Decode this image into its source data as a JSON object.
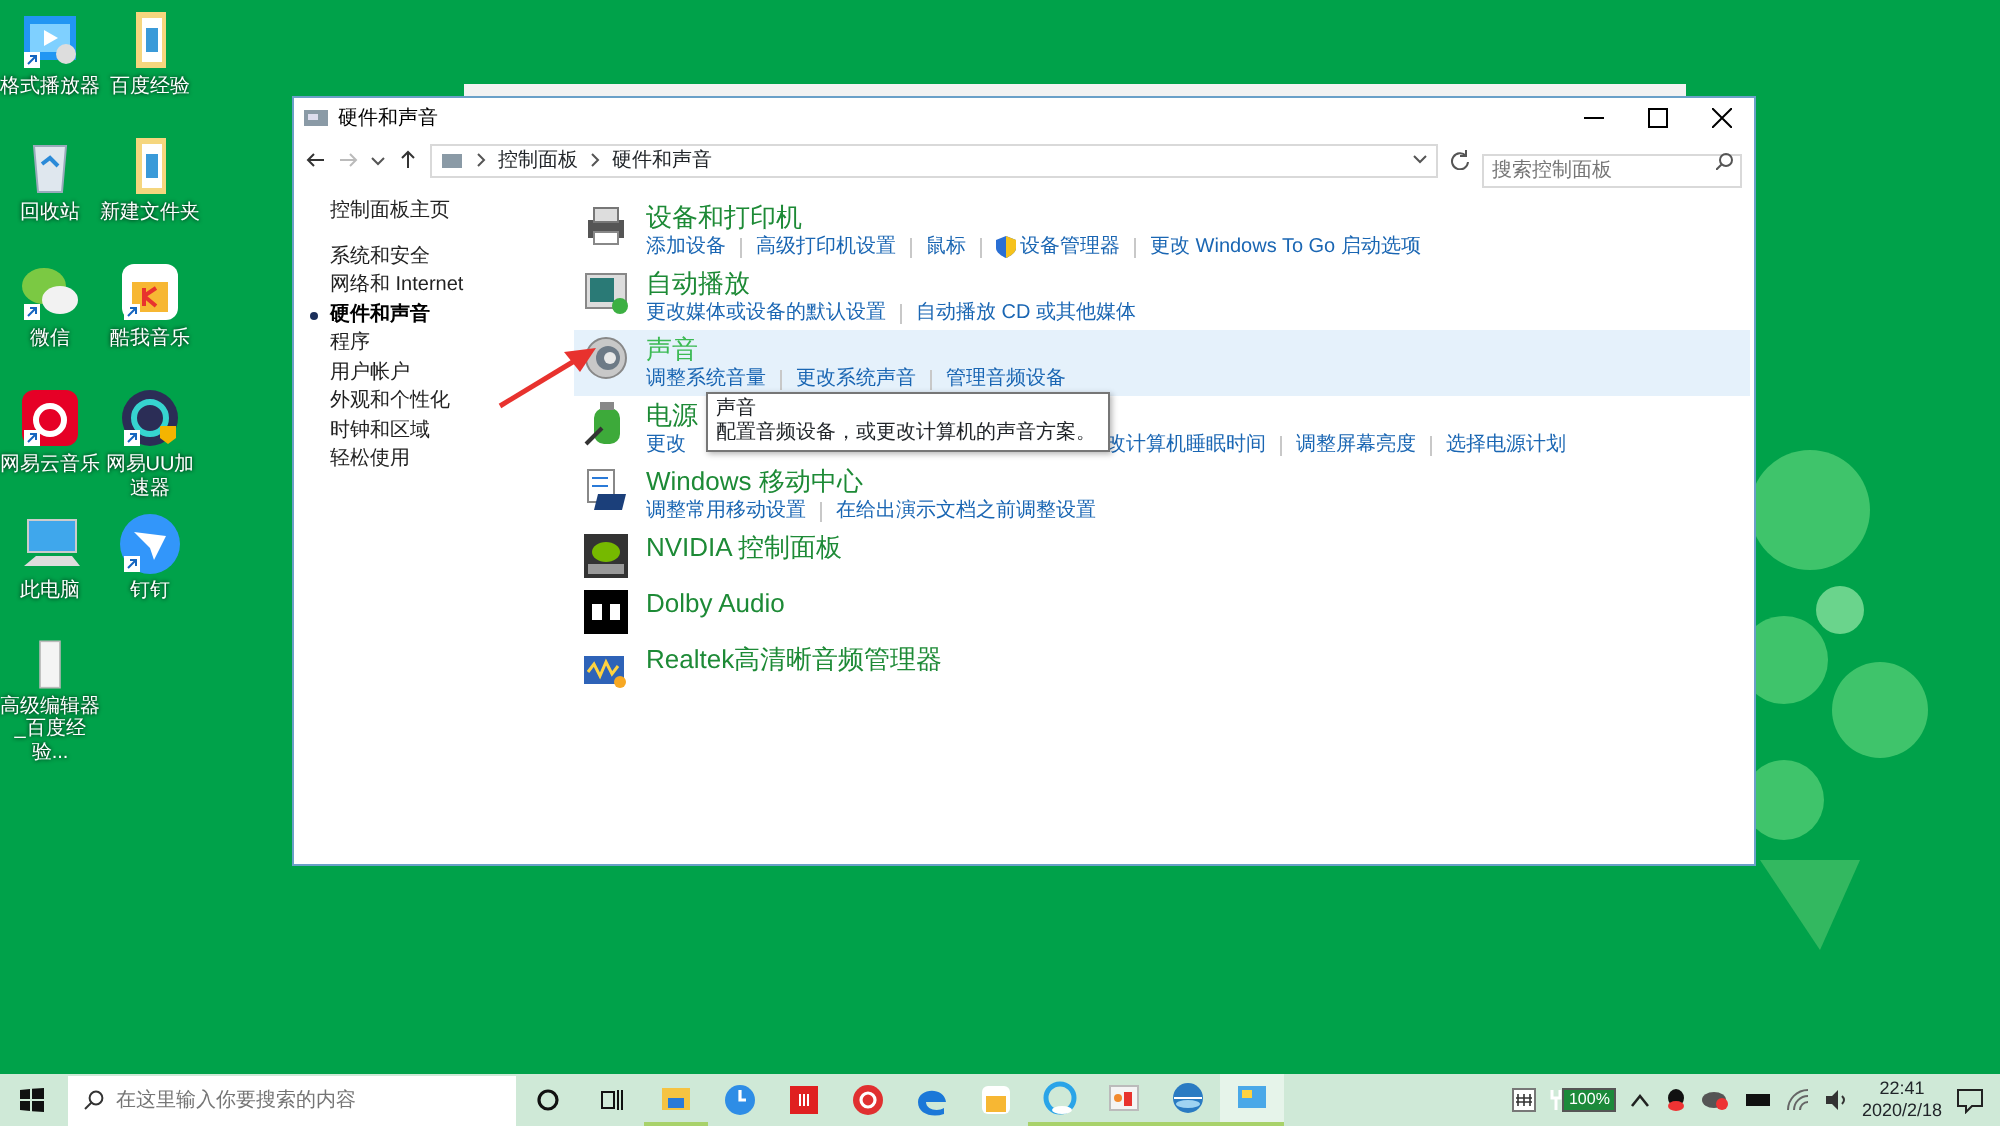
{
  "desktop_icons": [
    {
      "label": "格式播放器",
      "kind": "video",
      "shortcut": true
    },
    {
      "label": "百度经验",
      "kind": "folder",
      "shortcut": false
    },
    {
      "label": "回收站",
      "kind": "recycle",
      "shortcut": false
    },
    {
      "label": "新建文件夹",
      "kind": "folder",
      "shortcut": false
    },
    {
      "label": "微信",
      "kind": "chat",
      "shortcut": true
    },
    {
      "label": "酷我音乐",
      "kind": "music",
      "shortcut": true
    },
    {
      "label": "网易云音乐",
      "kind": "netease",
      "shortcut": true
    },
    {
      "label": "网易UU加速器",
      "kind": "uu",
      "shortcut": true
    },
    {
      "label": "此电脑",
      "kind": "pc",
      "shortcut": false
    },
    {
      "label": "钉钉",
      "kind": "dingtalk",
      "shortcut": true
    },
    {
      "label": "高级编辑器_百度经验...",
      "kind": "file",
      "shortcut": false
    }
  ],
  "window": {
    "title": "硬件和声音",
    "breadcrumb": [
      "控制面板",
      "硬件和声音"
    ],
    "search": {
      "placeholder": "搜索控制面板"
    }
  },
  "nav": {
    "home": "控制面板主页",
    "items": [
      {
        "label": "系统和安全",
        "selected": false
      },
      {
        "label": "网络和 Internet",
        "selected": false
      },
      {
        "label": "硬件和声音",
        "selected": true
      },
      {
        "label": "程序",
        "selected": false
      },
      {
        "label": "用户帐户",
        "selected": false
      },
      {
        "label": "外观和个性化",
        "selected": false
      },
      {
        "label": "时钟和区域",
        "selected": false
      },
      {
        "label": "轻松使用",
        "selected": false
      }
    ]
  },
  "categories": [
    {
      "kind": "printer",
      "title": "设备和打印机",
      "hovered": false,
      "links": [
        {
          "text": "添加设备",
          "shield": false
        },
        {
          "text": "高级打印机设置",
          "shield": false
        },
        {
          "text": "鼠标",
          "shield": false
        },
        {
          "text": "设备管理器",
          "shield": true
        },
        {
          "text": "更改 Windows To Go 启动选项",
          "shield": false
        }
      ]
    },
    {
      "kind": "autoplay",
      "title": "自动播放",
      "hovered": false,
      "links": [
        {
          "text": "更改媒体或设备的默认设置",
          "shield": false
        },
        {
          "text": "自动播放 CD 或其他媒体",
          "shield": false
        }
      ]
    },
    {
      "kind": "sound",
      "title": "声音",
      "hovered": true,
      "links": [
        {
          "text": "调整系统音量",
          "shield": false
        },
        {
          "text": "更改系统声音",
          "shield": false
        },
        {
          "text": "管理音频设备",
          "shield": false
        }
      ]
    },
    {
      "kind": "power",
      "title": "电源",
      "hovered": false,
      "links": [
        {
          "text": "更改",
          "shield": false
        },
        {
          "text": "改计算机睡眠时间",
          "shield": false
        },
        {
          "text": "调整屏幕亮度",
          "shield": false
        },
        {
          "text": "选择电源计划",
          "shield": false
        }
      ]
    },
    {
      "kind": "mobility",
      "title": "Windows 移动中心",
      "hovered": false,
      "links": [
        {
          "text": "调整常用移动设置",
          "shield": false
        },
        {
          "text": "在给出演示文档之前调整设置",
          "shield": false
        }
      ]
    },
    {
      "kind": "nvidia",
      "title": "NVIDIA 控制面板",
      "hovered": false
    },
    {
      "kind": "dolby",
      "title": "Dolby Audio",
      "hovered": false
    },
    {
      "kind": "realtek",
      "title": "Realtek高清晰音频管理器",
      "hovered": false
    }
  ],
  "tooltip": {
    "title": "声音",
    "text": "配置音频设备，或更改计算机的声音方案。"
  },
  "taskbar": {
    "search": {
      "placeholder": "在这里输入你要搜索的内容"
    },
    "apps": [
      {
        "kind": "explorer",
        "running": true,
        "active": false
      },
      {
        "kind": "clock",
        "running": false,
        "active": false
      },
      {
        "kind": "red",
        "running": false,
        "active": false
      },
      {
        "kind": "ie360",
        "running": false,
        "active": false
      },
      {
        "kind": "edge",
        "running": false,
        "active": false
      },
      {
        "kind": "music",
        "running": false,
        "active": false
      },
      {
        "kind": "browser",
        "running": true,
        "active": false
      },
      {
        "kind": "slides",
        "running": true,
        "active": false
      },
      {
        "kind": "globe",
        "running": true,
        "active": false
      },
      {
        "kind": "panel",
        "running": true,
        "active": true
      }
    ],
    "battery": "100%",
    "time": "22:41",
    "date": "2020/2/18"
  }
}
